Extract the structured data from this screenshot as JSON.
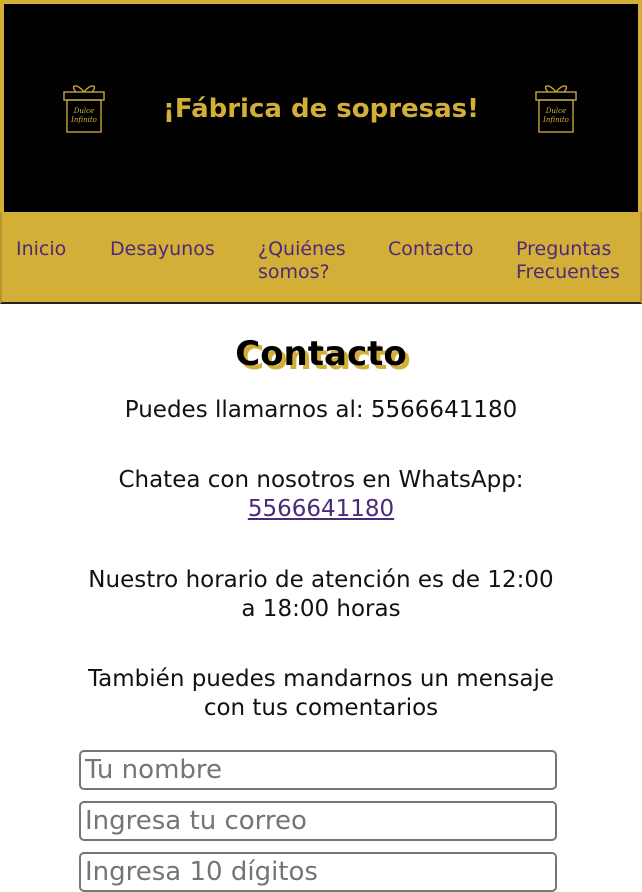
{
  "header": {
    "title": "¡Fábrica de sopresas!",
    "logo_text_line1": "Dulce",
    "logo_text_line2": "Infinito"
  },
  "nav": {
    "items": [
      {
        "label": "Inicio"
      },
      {
        "label": "Desayunos"
      },
      {
        "label": "¿Quiénes somos?"
      },
      {
        "label": "Contacto"
      },
      {
        "label": "Preguntas Frecuentes"
      }
    ]
  },
  "main": {
    "title": "Contacto",
    "phone_text": "Puedes llamarnos al: 5566641180",
    "whatsapp_text": "Chatea con nosotros en WhatsApp:",
    "whatsapp_number": "5566641180",
    "hours_text": "Nuestro horario de atención es de 12:00 a 18:00 horas",
    "message_text": "También puedes mandarnos un mensaje con tus comentarios"
  },
  "form": {
    "name_placeholder": "Tu nombre",
    "email_placeholder": "Ingresa tu correo",
    "digits_placeholder": "Ingresa 10 dígitos"
  },
  "colors": {
    "gold": "#d4af37",
    "purple": "#4b2a7a",
    "black": "#000000"
  }
}
